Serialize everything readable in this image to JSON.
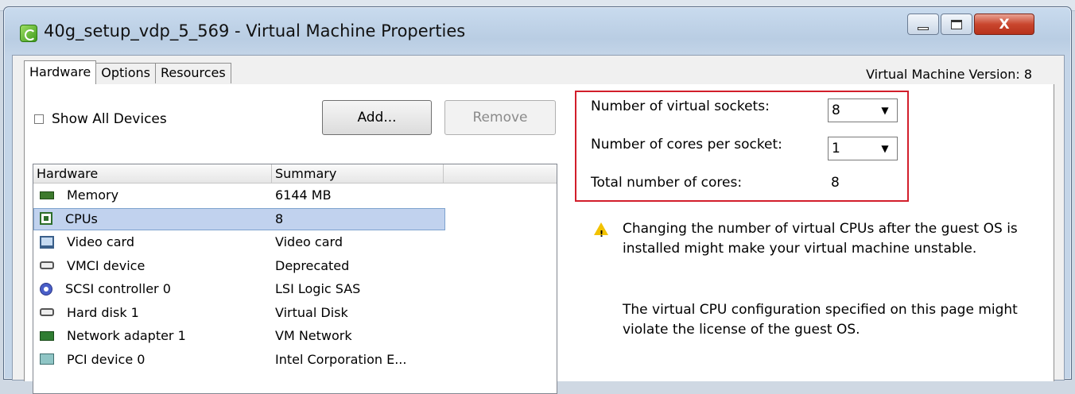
{
  "window": {
    "title": "40g_setup_vdp_5_569 - Virtual Machine Properties",
    "close_glyph": "X"
  },
  "tabs": [
    {
      "label": "Hardware",
      "active": true
    },
    {
      "label": "Options",
      "active": false
    },
    {
      "label": "Resources",
      "active": false
    }
  ],
  "vm_version": "Virtual Machine Version: 8",
  "hardware": {
    "show_all_label": "Show All Devices",
    "show_all_checked": false,
    "add_label": "Add...",
    "remove_label": "Remove",
    "columns": [
      "Hardware",
      "Summary",
      ""
    ],
    "rows": [
      {
        "icon": "memory-icon",
        "name": "Memory",
        "summary": "6144 MB"
      },
      {
        "icon": "cpu-icon",
        "name": "CPUs",
        "summary": "8",
        "selected": true
      },
      {
        "icon": "video-card-icon",
        "name": "Video card",
        "summary": "Video card"
      },
      {
        "icon": "vmci-device-icon",
        "name": "VMCI device",
        "summary": "Deprecated"
      },
      {
        "icon": "scsi-controller-icon",
        "name": "SCSI controller 0",
        "summary": "LSI Logic SAS"
      },
      {
        "icon": "hard-disk-icon",
        "name": "Hard disk 1",
        "summary": "Virtual Disk"
      },
      {
        "icon": "network-adapter-icon",
        "name": "Network adapter 1",
        "summary": "VM Network"
      },
      {
        "icon": "pci-device-icon",
        "name": "PCI device 0",
        "summary": "Intel Corporation E..."
      }
    ]
  },
  "cpu": {
    "sockets_label": "Number of virtual sockets:",
    "sockets_value": "8",
    "cores_label": "Number of cores per socket:",
    "cores_value": "1",
    "total_label": "Total number of cores:",
    "total_value": "8",
    "highlight_color": "#d21e2b"
  },
  "warning": {
    "icon": "warning-icon",
    "text": "Changing the number of virtual CPUs after the guest OS is installed might make your virtual machine unstable."
  },
  "license_note": "The virtual CPU configuration specified on this page might violate the license of the guest OS."
}
